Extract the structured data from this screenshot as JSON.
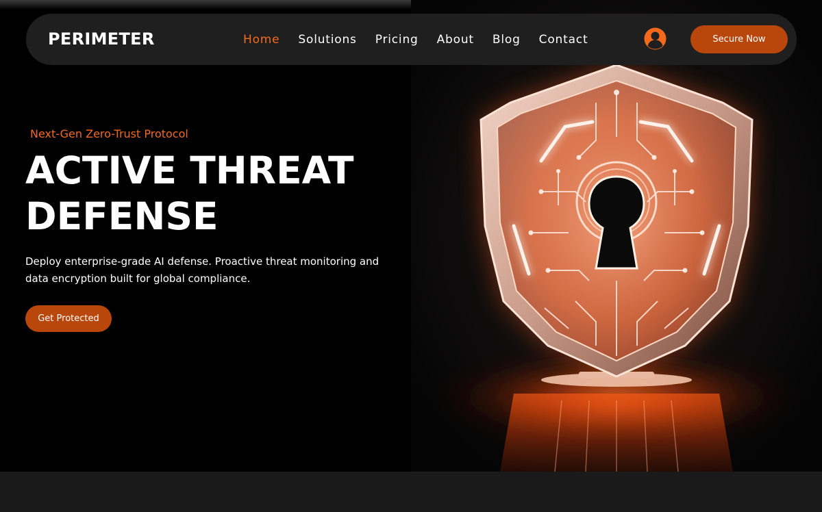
{
  "navbar": {
    "logo": "PERIMETER",
    "links": [
      {
        "label": "Home",
        "active": true
      },
      {
        "label": "Solutions",
        "active": false
      },
      {
        "label": "Pricing",
        "active": false
      },
      {
        "label": "About",
        "active": false
      },
      {
        "label": "Blog",
        "active": false
      },
      {
        "label": "Contact",
        "active": false
      }
    ],
    "cta_label": "Secure Now",
    "account_icon": "user-circle-icon"
  },
  "hero": {
    "eyebrow": "Next-Gen Zero-Trust Protocol",
    "headline_line1": "ACTIVE THREAT",
    "headline_line2": "DEFENSE",
    "subtext": "Deploy enterprise-grade AI defense. Proactive threat monitoring and data encryption built for global compliance.",
    "button_label": "Get Protected",
    "image_subject": "glowing circuit shield with keyhole"
  },
  "colors": {
    "accent": "#f36a1c",
    "button": "#b9470c",
    "background": "#000000",
    "navbar": "#1f1f1f"
  }
}
